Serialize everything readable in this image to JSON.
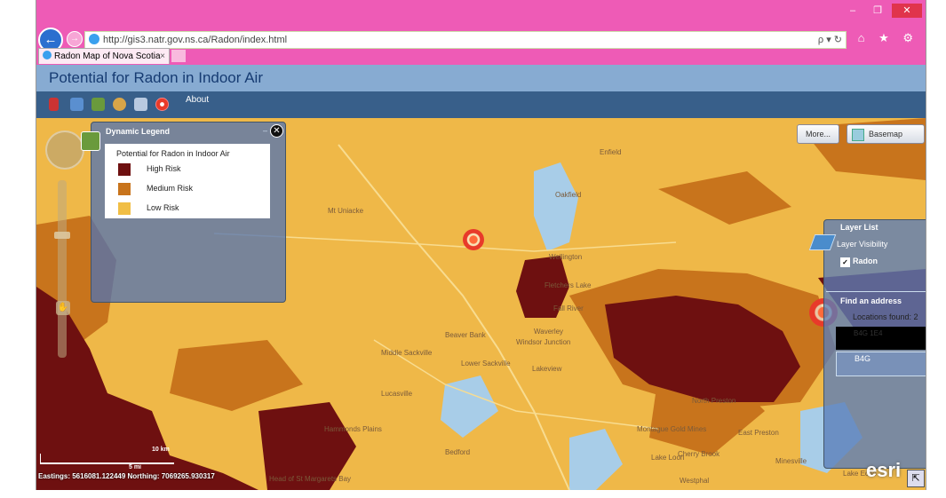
{
  "browser": {
    "url": "http://gis3.natr.gov.ns.ca/Radon/index.html",
    "tab_title": "Radon Map of Nova Scotia",
    "tab_close": "×",
    "addr_tools": "ρ ▾ ↻",
    "right_icons": "⌂ ★ ⚙",
    "window_controls": {
      "minimize": "–",
      "restore": "❐",
      "close": "✕"
    }
  },
  "app": {
    "title": "Potential for Radon in Indoor Air",
    "toolbar": {
      "about": "About"
    }
  },
  "legend": {
    "title": "Dynamic Legend",
    "minimize": "–",
    "close": "✕",
    "subtitle": "Potential for Radon in Indoor Air",
    "items": [
      {
        "label": "High Risk",
        "color": "#6e1010"
      },
      {
        "label": "Medium Risk",
        "color": "#c8741c"
      },
      {
        "label": "Low Risk",
        "color": "#f1be45"
      }
    ]
  },
  "buttons": {
    "more": "More...",
    "basemap": "Basemap"
  },
  "layer_list": {
    "title": "Layer List",
    "visibility": "Layer Visibility",
    "layer": "Radon",
    "checked_mark": "✓"
  },
  "find_address": {
    "title": "Find an address",
    "locations_found": "Locations found: 2",
    "results": [
      "B4G 1E4",
      "B4G"
    ]
  },
  "map": {
    "place_labels": [
      "Enfield",
      "Oakfield",
      "Mt Uniacke",
      "Wellington",
      "Fletchers Lake",
      "Fall River",
      "Beaver Bank",
      "Windsor Junction",
      "Lower Sackville",
      "Lakeview",
      "Lucasville",
      "Hammonds Plains",
      "Bedford",
      "North Preston",
      "Montague Gold Mines",
      "East Preston",
      "Lake Loon",
      "Cherry Brook",
      "Minesville",
      "Lake Echo",
      "Westphal",
      "Head of St Margarets Bay",
      "Middle Sackville",
      "Waverley"
    ],
    "scale_km": "10 km",
    "scale_mi": "5 mi",
    "coords": "Eastings: 5616081.122449 Northing: 7069265.930317",
    "esri": "esri",
    "corner_icon": "⇱",
    "colors": {
      "low": "#f1be45",
      "medium": "#c8741c",
      "high": "#6e1010",
      "water": "#a8cde8"
    }
  }
}
